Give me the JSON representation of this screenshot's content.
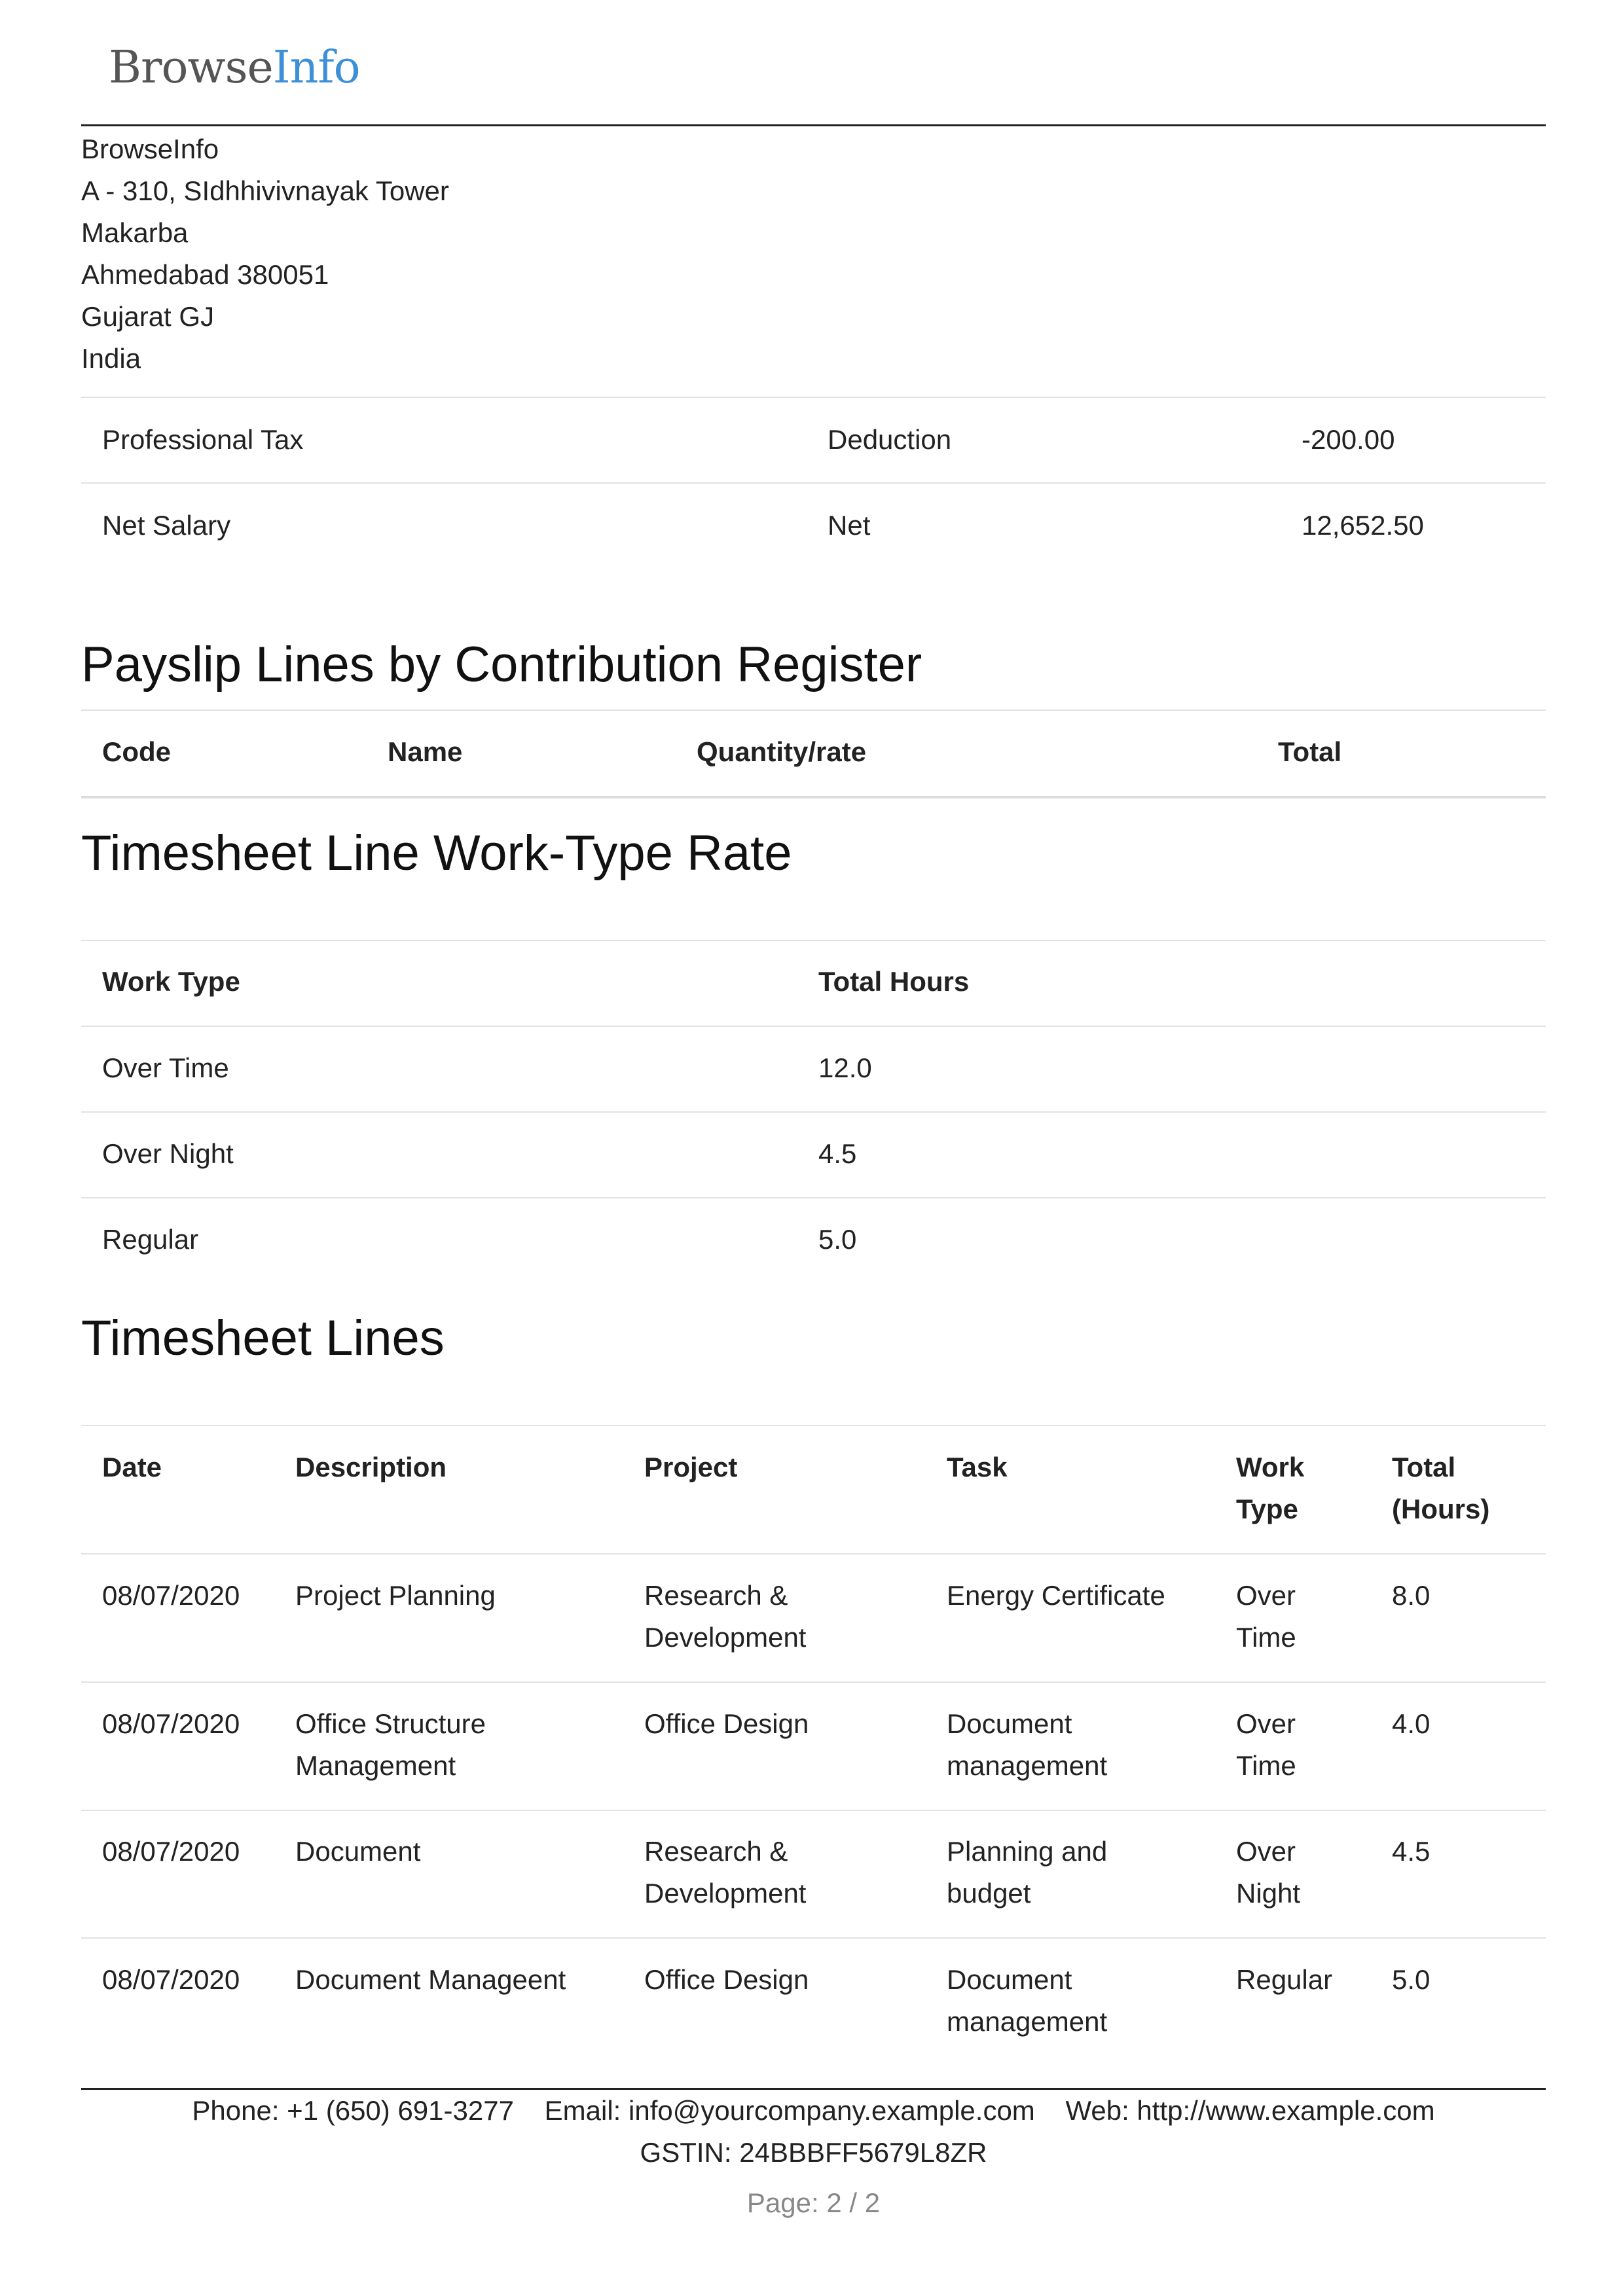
{
  "logo": {
    "part1": "Browse",
    "part2": "Info"
  },
  "company": {
    "address_lines": [
      "BrowseInfo",
      "A - 310, SIdhhivivnayak Tower",
      "Makarba",
      "Ahmedabad 380051",
      "Gujarat GJ",
      "India"
    ]
  },
  "salary_rows": [
    {
      "name": "Professional Tax",
      "category": "Deduction",
      "amount": "-200.00"
    },
    {
      "name": "Net Salary",
      "category": "Net",
      "amount": "12,652.50"
    }
  ],
  "contribution": {
    "title": "Payslip Lines by Contribution Register",
    "headers": {
      "code": "Code",
      "name": "Name",
      "qty": "Quantity/rate",
      "total": "Total"
    }
  },
  "worktype": {
    "title": "Timesheet Line Work-Type Rate",
    "headers": {
      "type": "Work Type",
      "hours": "Total Hours"
    },
    "rows": [
      {
        "type": "Over Time",
        "hours": "12.0"
      },
      {
        "type": "Over Night",
        "hours": "4.5"
      },
      {
        "type": "Regular",
        "hours": "5.0"
      }
    ]
  },
  "timesheet": {
    "title": "Timesheet Lines",
    "headers": {
      "date": "Date",
      "desc": "Description",
      "project": "Project",
      "task": "Task",
      "wt1": "Work",
      "wt2": "Type",
      "tot1": "Total",
      "tot2": "(Hours)"
    },
    "rows": [
      {
        "date": "08/07/2020",
        "desc": [
          "Project Planning",
          ""
        ],
        "project": [
          "Research &",
          "Development"
        ],
        "task": [
          "Energy Certificate",
          ""
        ],
        "wt": [
          "Over",
          "Time"
        ],
        "total": "8.0"
      },
      {
        "date": "08/07/2020",
        "desc": [
          "Office Structure",
          "Management"
        ],
        "project": [
          "Office Design",
          ""
        ],
        "task": [
          "Document",
          "management"
        ],
        "wt": [
          "Over",
          "Time"
        ],
        "total": "4.0"
      },
      {
        "date": "08/07/2020",
        "desc": [
          "Document",
          ""
        ],
        "project": [
          "Research &",
          "Development"
        ],
        "task": [
          "Planning and",
          "budget"
        ],
        "wt": [
          "Over",
          "Night"
        ],
        "total": "4.5"
      },
      {
        "date": "08/07/2020",
        "desc": [
          "Document Manageent",
          ""
        ],
        "project": [
          "Office Design",
          ""
        ],
        "task": [
          "Document",
          "management"
        ],
        "wt": [
          "Regular",
          ""
        ],
        "total": "5.0"
      }
    ]
  },
  "footer": {
    "phone": "Phone: +1 (650) 691-3277",
    "email": "Email: info@yourcompany.example.com",
    "web": "Web: http://www.example.com",
    "gstin": "GSTIN: 24BBBFF5679L8ZR",
    "page": "Page: 2 / 2"
  }
}
